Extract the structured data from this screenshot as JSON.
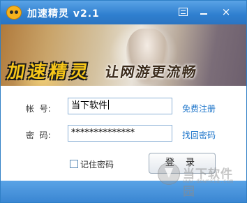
{
  "window": {
    "title": "加速精灵 v2.1",
    "controls": {
      "menu_icon": "menu-icon",
      "minimize_icon": "minimize-icon",
      "close_label": "×"
    }
  },
  "banner": {
    "slogan_main": "加速精灵",
    "slogan_sub": "让网游更流畅"
  },
  "form": {
    "username_label": "帐  号:",
    "username_value": "当下软件",
    "password_label": "密  码:",
    "password_value": "**************",
    "register_link": "免费注册",
    "forgot_link": "找回密码",
    "remember_label": "记住密码",
    "remember_checked": false,
    "login_button": "登 录"
  },
  "watermark": {
    "text": "当下软件园",
    "url": "www.downxia.com"
  },
  "colors": {
    "titlebar": "#2f7fcf",
    "link": "#1a73c9",
    "slogan": "#f6c619"
  }
}
